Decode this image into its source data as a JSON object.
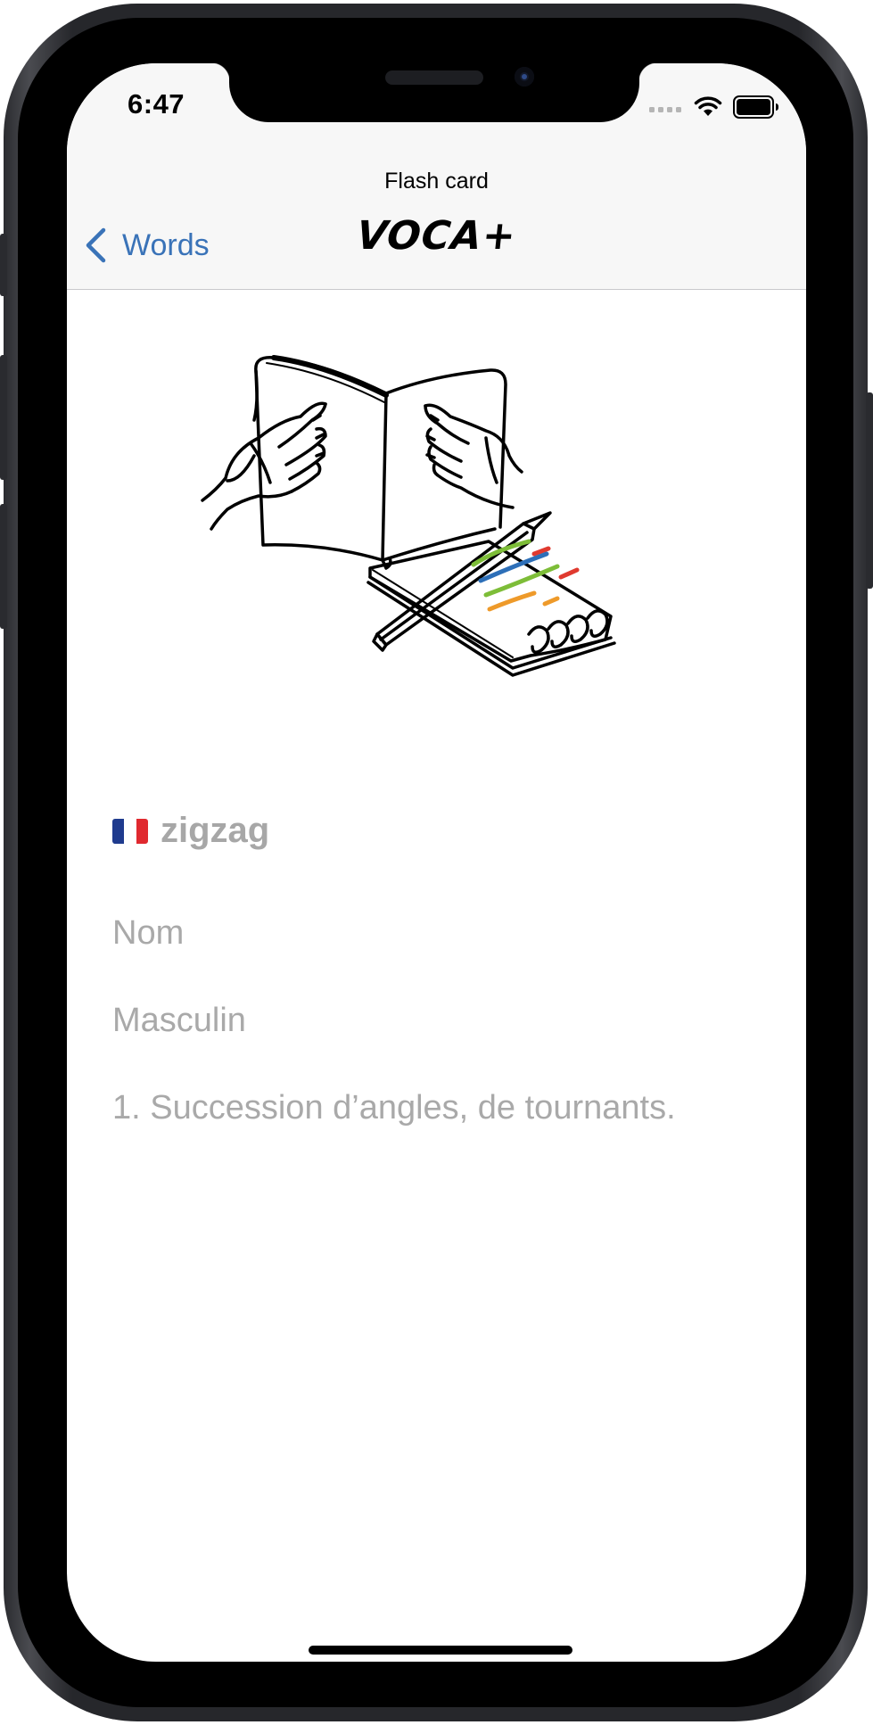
{
  "status_bar": {
    "time": "6:47"
  },
  "nav": {
    "caption": "Flash card",
    "back_label": "Words",
    "logo": "VOCA+"
  },
  "card": {
    "word": "zigzag",
    "language_flag": "french-flag",
    "part_of_speech": "Nom",
    "gender": "Masculin",
    "definition": "1. Succession d’angles, de tournants."
  },
  "colors": {
    "accent": "#3a73b8",
    "muted_text": "#a9a9a9",
    "flag_blue": "#1f3b8e",
    "flag_red": "#e0292f",
    "highlight_green": "#7dbd38",
    "highlight_blue": "#2d6fb8",
    "highlight_red": "#e03a2f",
    "highlight_orange": "#ee9a2a"
  }
}
